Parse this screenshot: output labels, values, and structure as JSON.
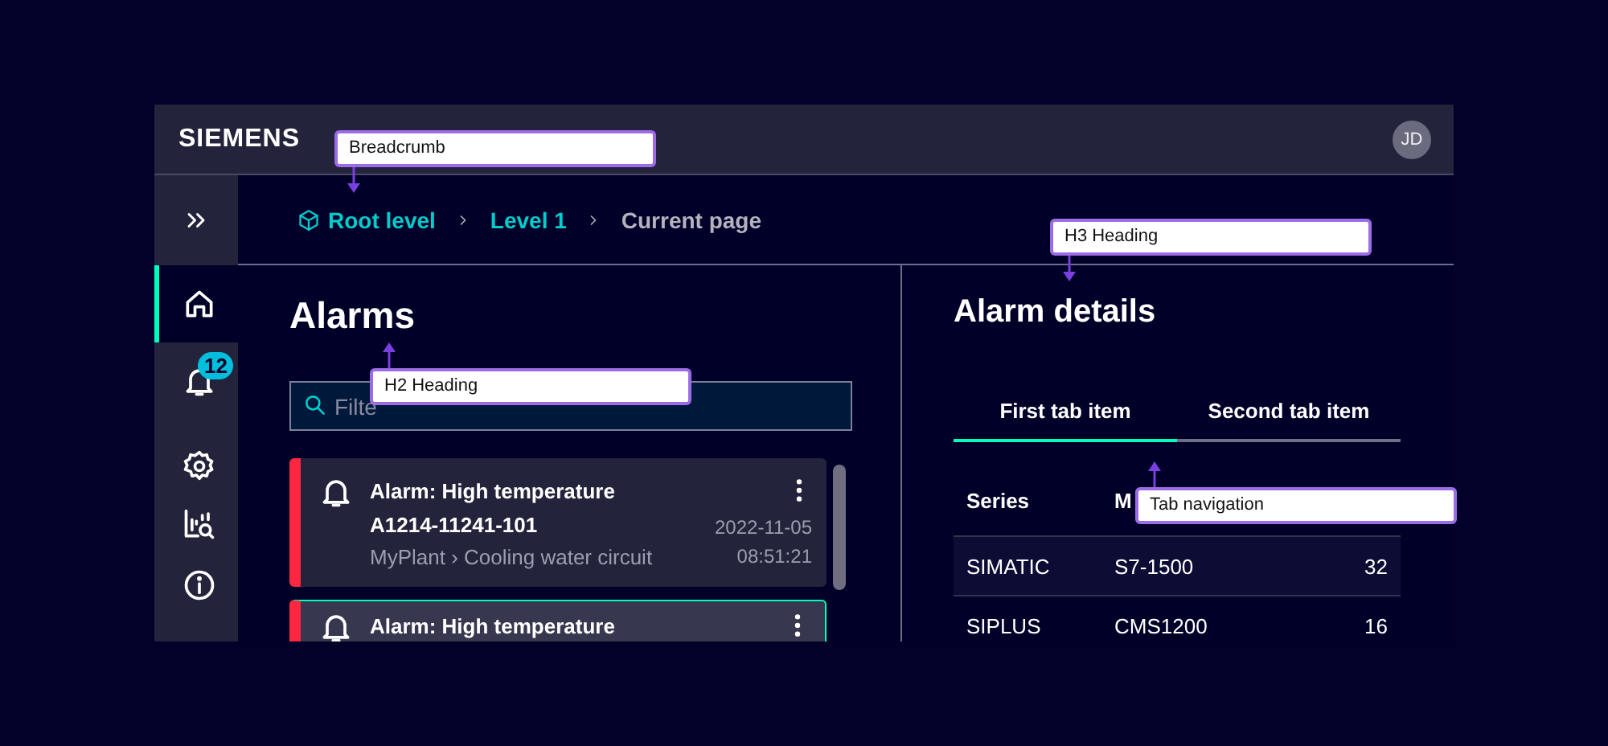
{
  "header": {
    "brand": "SIEMENS",
    "avatar": "JD"
  },
  "sidebar": {
    "items": [
      {
        "selected": true
      },
      {
        "selected": false,
        "badge": "12"
      },
      {
        "selected": false
      },
      {
        "selected": false
      },
      {
        "selected": false
      }
    ]
  },
  "breadcrumb": [
    {
      "label": "Root level",
      "current": false,
      "icon": true
    },
    {
      "label": "Level 1",
      "current": false
    },
    {
      "label": "Current page",
      "current": true
    }
  ],
  "alarms": {
    "title": "Alarms",
    "filter": {
      "placeholder": "Filte"
    },
    "cards": [
      {
        "title": "Alarm: High temperature",
        "id": "A1214-11241-101",
        "location": "MyPlant › Cooling water circuit",
        "date": "2022-11-05",
        "time": "08:51:21",
        "selected": false,
        "color": "#ff2640"
      },
      {
        "title": "Alarm: High temperature",
        "selected": true,
        "color": "#ff2640"
      }
    ]
  },
  "details": {
    "title": "Alarm details",
    "tabs": [
      {
        "label": "First tab item",
        "selected": true
      },
      {
        "label": "Second tab item",
        "selected": false
      }
    ],
    "table": {
      "columns": [
        "Series",
        "M"
      ],
      "rows": [
        [
          "SIMATIC",
          "S7-1500",
          "32"
        ],
        [
          "SIPLUS",
          "CMS1200",
          "16"
        ]
      ]
    }
  },
  "annotations": [
    {
      "label": "Breadcrumb"
    },
    {
      "label": "H3 Heading"
    },
    {
      "label": "H2 Heading"
    },
    {
      "label": "Tab navigation"
    }
  ]
}
